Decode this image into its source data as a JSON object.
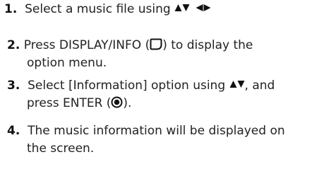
{
  "steps": [
    {
      "number": "1.",
      "text_before": "Select a music file using",
      "icons": [
        "arrow-up-icon",
        "arrow-down-icon",
        "arrow-left-icon",
        "arrow-right-icon"
      ]
    },
    {
      "number": "2.",
      "text_before": "Press DISPLAY/INFO (",
      "icon": "display-info-button-icon",
      "text_after": ") to display the",
      "line2": "option menu."
    },
    {
      "number": "3.",
      "text_before": "Select [Information] option using",
      "icons": [
        "arrow-up-icon",
        "arrow-down-icon"
      ],
      "text_after": ", and",
      "line2_before": "press ENTER (",
      "line2_icon": "enter-button-icon",
      "line2_after": ")."
    },
    {
      "number": "4.",
      "text_before": "The music information will be displayed on",
      "line2": "the screen."
    }
  ]
}
